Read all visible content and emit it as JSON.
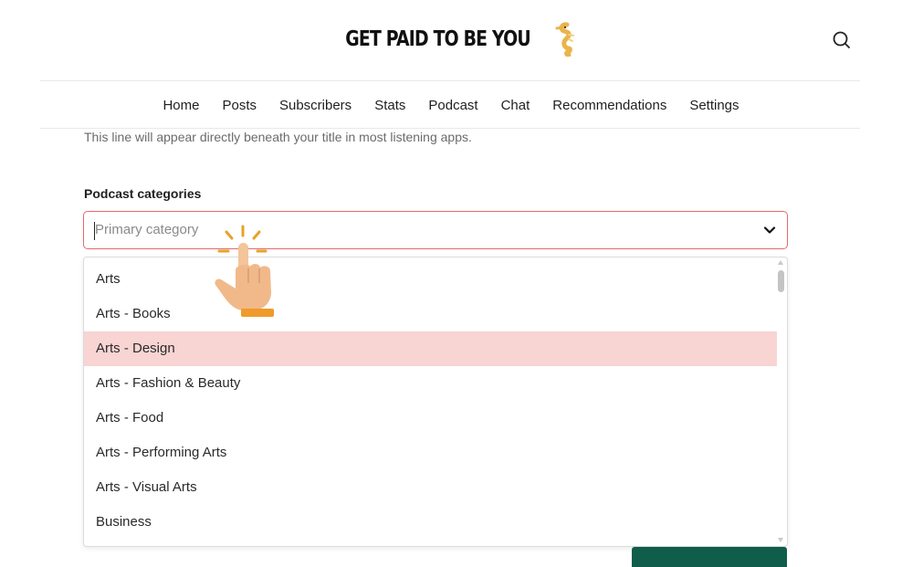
{
  "brand": {
    "title": "GET PAID TO BE YOU",
    "logo_icon": "seahorse-icon"
  },
  "header": {
    "search_icon": "search-icon"
  },
  "nav": {
    "items": [
      "Home",
      "Posts",
      "Subscribers",
      "Stats",
      "Podcast",
      "Chat",
      "Recommendations",
      "Settings"
    ]
  },
  "form": {
    "helper_text": "This line will appear directly beneath your title in most listening apps.",
    "categories_label": "Podcast categories",
    "primary_category": {
      "value": "",
      "placeholder": "Primary category",
      "border_color": "#e2696b"
    }
  },
  "dropdown": {
    "options": [
      "Arts",
      "Arts - Books",
      "Arts - Design",
      "Arts - Fashion & Beauty",
      "Arts - Food",
      "Arts - Performing Arts",
      "Arts - Visual Arts",
      "Business"
    ],
    "highlighted": "Arts - Design",
    "highlight_color": "#f8d4d3"
  },
  "colors": {
    "accent_button": "#0f5d4a"
  },
  "overlay": {
    "cursor_icon": "pointer-hand-icon"
  }
}
